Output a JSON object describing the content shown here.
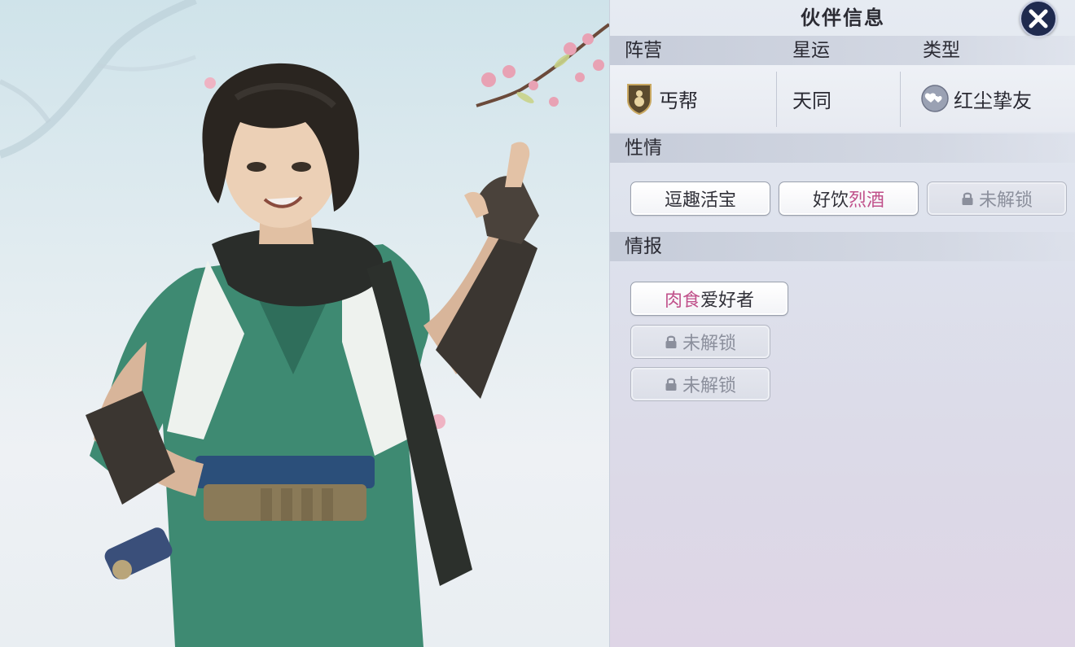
{
  "panel": {
    "title": "伙伴信息",
    "headers": {
      "faction": "阵营",
      "star": "星运",
      "type": "类型"
    },
    "faction": {
      "value": "丐帮",
      "icon": "gourd-shield-icon"
    },
    "star": {
      "value": "天同"
    },
    "type": {
      "value": "红尘挚友",
      "icon": "hearts-icon"
    },
    "temperament": {
      "label": "性情",
      "tags": [
        {
          "text": "逗趣活宝"
        },
        {
          "prefix": "好饮",
          "highlight": "烈酒"
        },
        {
          "text": "未解锁",
          "locked": true
        }
      ]
    },
    "intel": {
      "label": "情报",
      "tags": [
        {
          "highlight": "肉食",
          "suffix": "爱好者"
        },
        {
          "text": "未解锁",
          "locked": true
        },
        {
          "text": "未解锁",
          "locked": true
        }
      ]
    }
  },
  "colors": {
    "highlight": "#c0508a",
    "close_bg": "#1f2a4e"
  }
}
